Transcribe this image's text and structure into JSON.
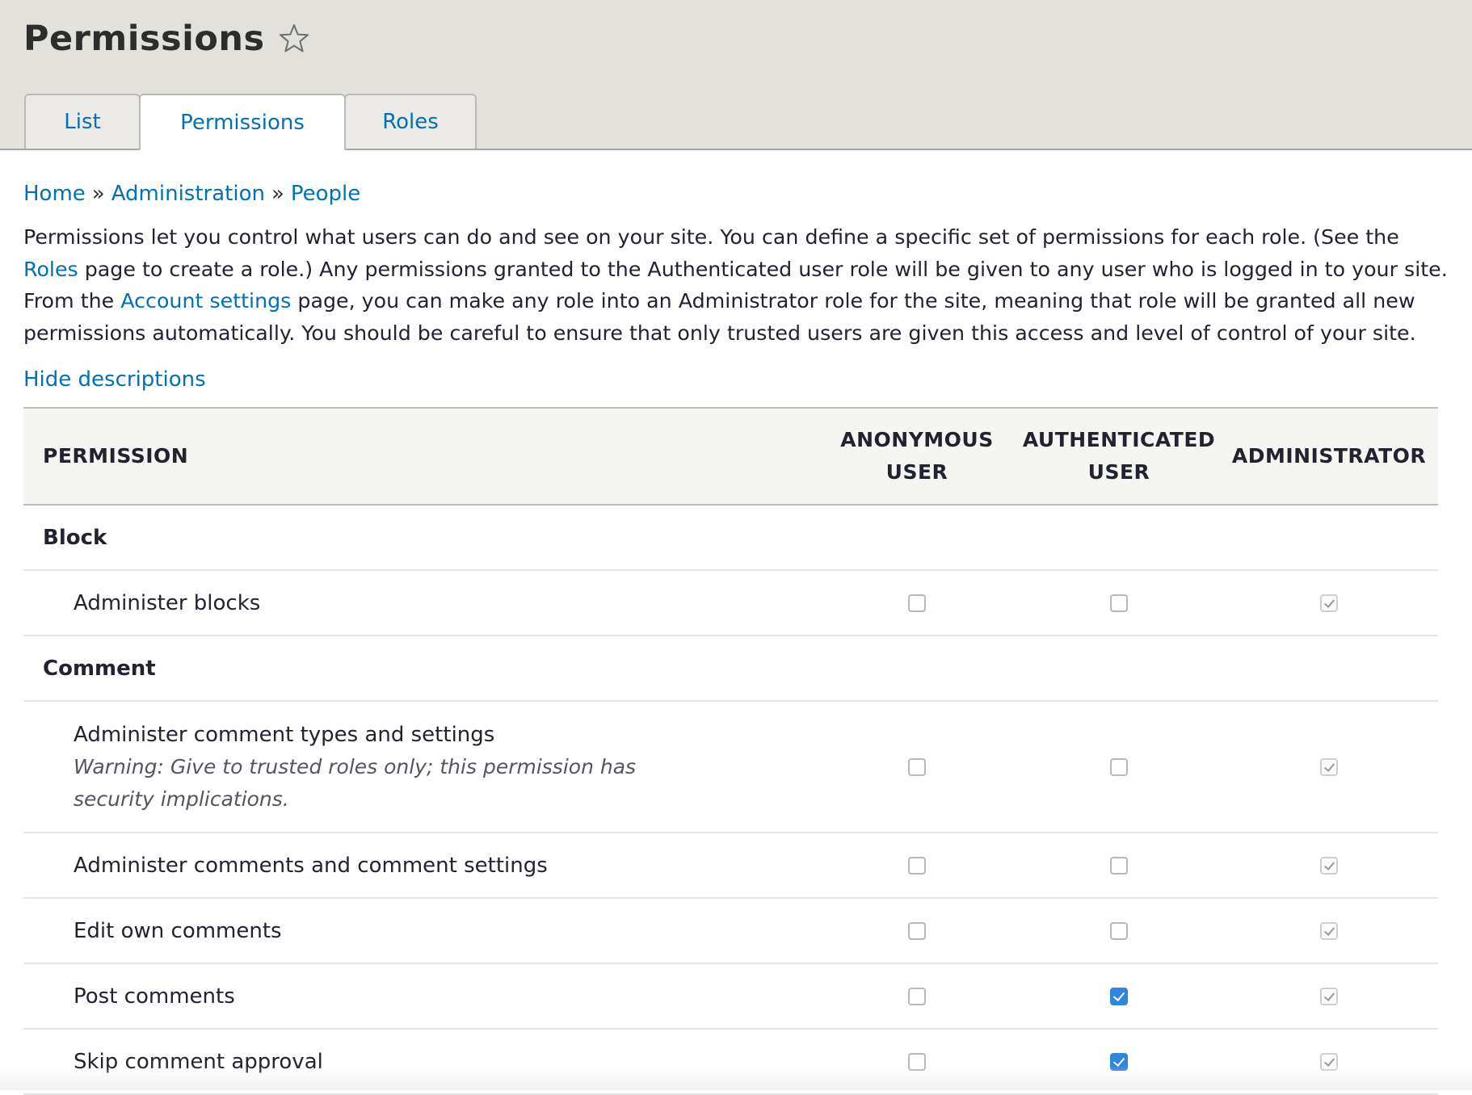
{
  "header": {
    "title": "Permissions",
    "favorite_icon": "star-outline-icon"
  },
  "tabs": [
    {
      "label": "List",
      "active": false
    },
    {
      "label": "Permissions",
      "active": true
    },
    {
      "label": "Roles",
      "active": false
    }
  ],
  "breadcrumb": {
    "items": [
      "Home",
      "Administration",
      "People"
    ],
    "separator": "»"
  },
  "intro": {
    "part1": "Permissions let you control what users can do and see on your site. You can define a specific set of permissions for each role. (See the ",
    "roles_link": "Roles",
    "part2": " page to create a role.) Any permissions granted to the Authenticated user role will be given to any user who is logged in to your site. From the ",
    "account_link": "Account settings",
    "part3": " page, you can make any role into an Administrator role for the site, meaning that role will be granted all new permissions automatically. You should be careful to ensure that only trusted users are given this access and level of control of your site."
  },
  "hide_descriptions_label": "Hide descriptions",
  "table": {
    "headers": {
      "permission": "Permission",
      "anonymous_line1": "Anonymous",
      "anonymous_line2": "user",
      "authenticated_line1": "Authenticated",
      "authenticated_line2": "user",
      "administrator": "Administrator"
    },
    "modules": [
      {
        "name": "Block",
        "permissions": [
          {
            "name": "Administer blocks",
            "description": "",
            "anonymous": false,
            "authenticated": false,
            "administrator": true
          }
        ]
      },
      {
        "name": "Comment",
        "permissions": [
          {
            "name": "Administer comment types and settings",
            "description": "Warning: Give to trusted roles only; this permission has security implications.",
            "anonymous": false,
            "authenticated": false,
            "administrator": true
          },
          {
            "name": "Administer comments and comment settings",
            "description": "",
            "anonymous": false,
            "authenticated": false,
            "administrator": true
          },
          {
            "name": "Edit own comments",
            "description": "",
            "anonymous": false,
            "authenticated": false,
            "administrator": true
          },
          {
            "name": "Post comments",
            "description": "",
            "anonymous": false,
            "authenticated": true,
            "administrator": true
          },
          {
            "name": "Skip comment approval",
            "description": "",
            "anonymous": false,
            "authenticated": true,
            "administrator": true
          }
        ]
      }
    ]
  },
  "colors": {
    "link": "#0071b8",
    "header_bg": "#e2e1dc",
    "checkbox_checked": "#2f86de"
  }
}
